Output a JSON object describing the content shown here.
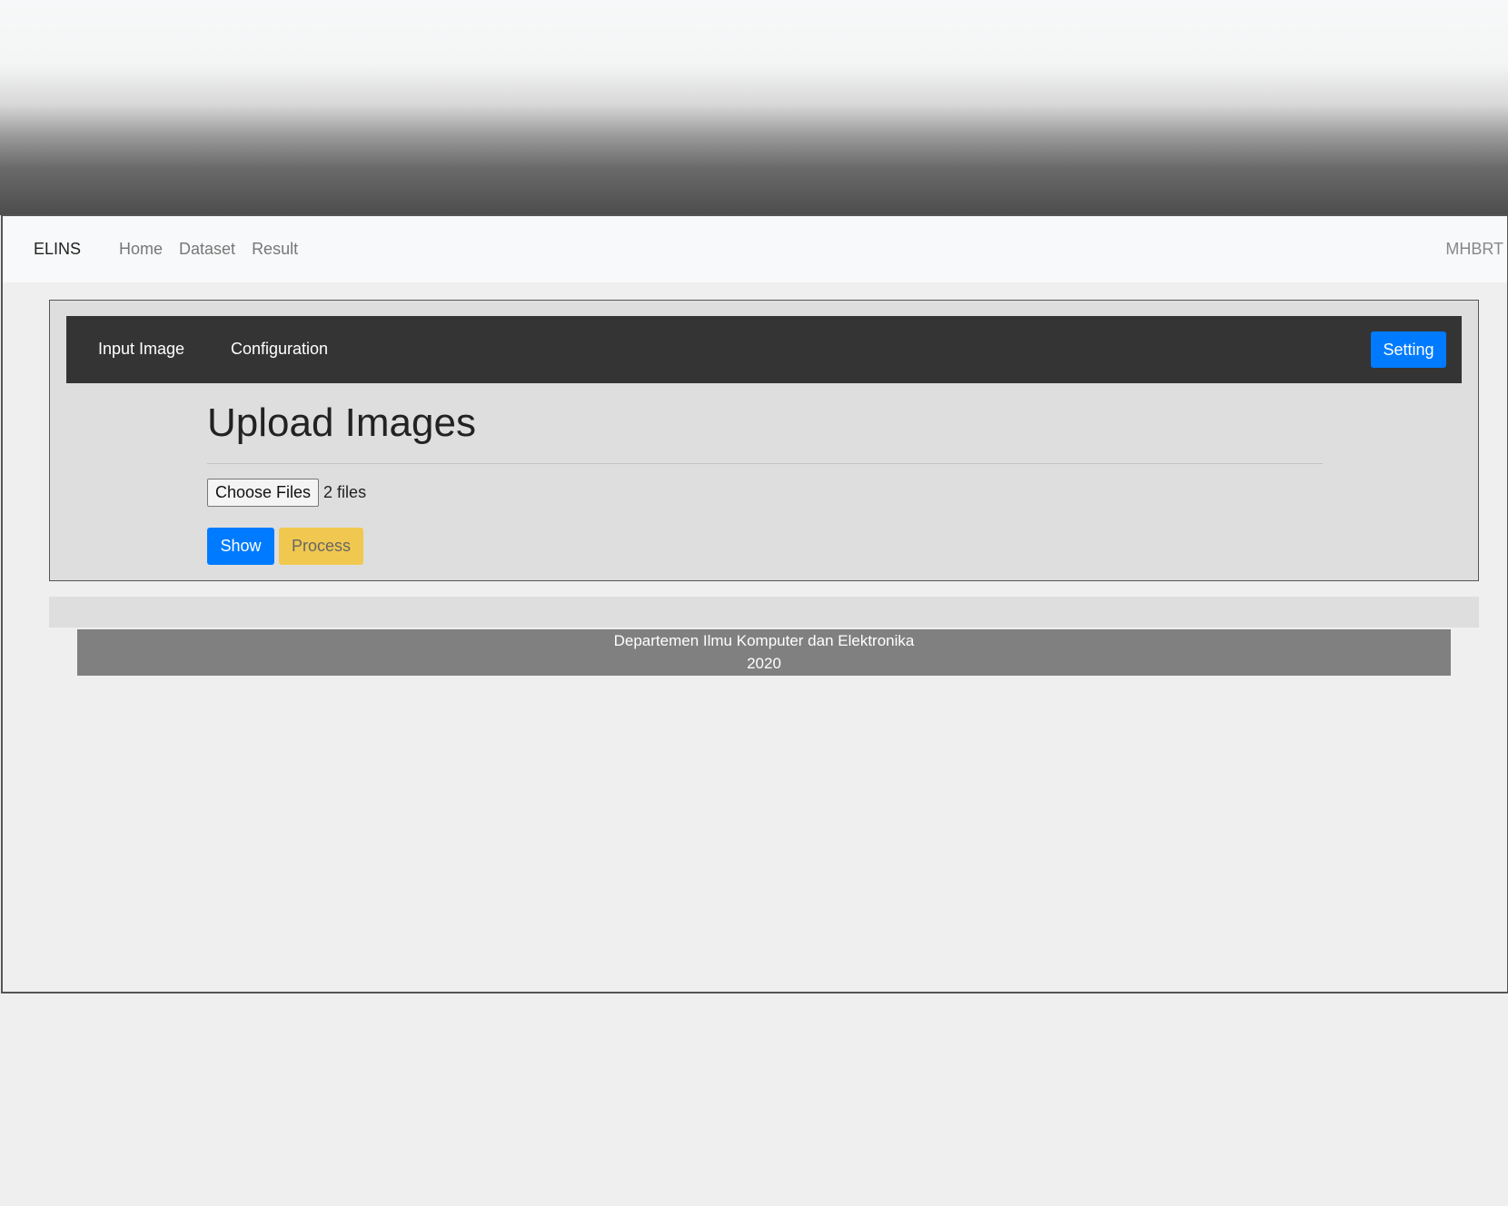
{
  "navbar": {
    "brand": "ELINS",
    "links": [
      "Home",
      "Dataset",
      "Result"
    ],
    "user": "MHBRT"
  },
  "panel": {
    "tabs": [
      "Input Image",
      "Configuration"
    ],
    "setting_label": "Setting",
    "title": "Upload Images",
    "file_input": {
      "button_label": "Choose Files",
      "status": "2 files"
    },
    "show_label": "Show",
    "process_label": "Process"
  },
  "footer": {
    "line1": "Departemen Ilmu Komputer dan Elektronika",
    "line2": "2020"
  },
  "colors": {
    "primary": "#007bff",
    "warning": "#f1c84f",
    "dark_bar": "#343434",
    "footer_bg": "#808080"
  }
}
